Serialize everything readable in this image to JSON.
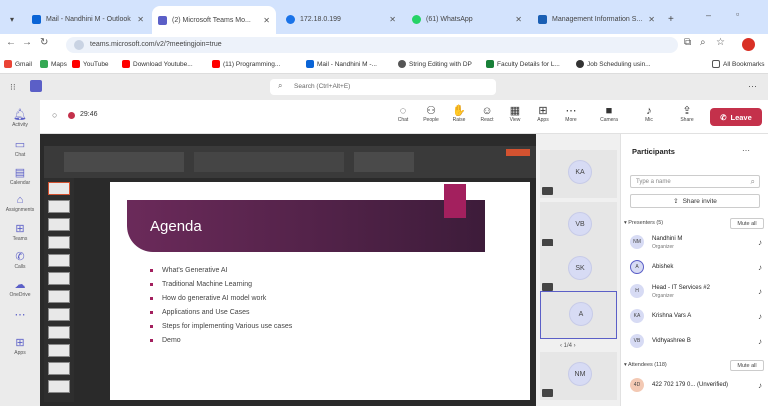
{
  "browser": {
    "tabs": [
      {
        "title": "Mail - Nandhini M - Outlook",
        "color": "#0a64d6"
      },
      {
        "title": "(2) Microsoft Teams Mo...",
        "color": "#5b5fc7",
        "active": true
      },
      {
        "title": "172.18.0.199",
        "color": "#1a73e8"
      },
      {
        "title": "(61) WhatsApp",
        "color": "#25d366"
      },
      {
        "title": "Management Information S...",
        "color": "#1a5fb4"
      }
    ],
    "url": "teams.microsoft.com/v2/?meetingjoin=true",
    "bookmarks": [
      "Gmail",
      "Maps",
      "YouTube",
      "Download Youtube...",
      "(11) Programming...",
      "Mail - Nandhini M -...",
      "String Editing with DP",
      "Faculty Details for L...",
      "Job Scheduling usin..."
    ],
    "all_bookmarks": "All Bookmarks"
  },
  "teams": {
    "search_placeholder": "Search (Ctrl+Alt+E)",
    "timer": "29:46",
    "controls": [
      {
        "label": "Chat",
        "icon": "chat-icon",
        "glyph": "◌"
      },
      {
        "label": "People",
        "icon": "people-icon",
        "glyph": "⚇"
      },
      {
        "label": "Raise",
        "icon": "raise-hand-icon",
        "glyph": "✋"
      },
      {
        "label": "React",
        "icon": "react-icon",
        "glyph": "☺"
      },
      {
        "label": "View",
        "icon": "view-icon",
        "glyph": "▦"
      },
      {
        "label": "Apps",
        "icon": "apps-icon",
        "glyph": "⊞"
      },
      {
        "label": "More",
        "icon": "more-icon",
        "glyph": "⋯"
      },
      {
        "label": "Camera",
        "icon": "camera-icon",
        "glyph": "■"
      },
      {
        "label": "Mic",
        "icon": "mic-icon",
        "glyph": "♪"
      },
      {
        "label": "Share",
        "icon": "share-icon",
        "glyph": "⇪"
      }
    ],
    "leave_label": "Leave",
    "rail": [
      "Activity",
      "Chat",
      "Calendar",
      "Assignments",
      "Teams",
      "Calls",
      "OneDrive",
      "",
      "Apps"
    ]
  },
  "slide": {
    "title": "Agenda",
    "bullets": [
      "What's Generative AI",
      "Traditional Machine Learning",
      "How do generative AI model work",
      "Applications and Use Cases",
      "Steps for implementing Various use cases",
      "Demo"
    ]
  },
  "videos": [
    "KA",
    "VB",
    "SK",
    "A",
    "NM"
  ],
  "pager": "1/4",
  "participants": {
    "title": "Participants",
    "type_placeholder": "Type a name",
    "share_invite": "Share invite",
    "presenters_label": "Presenters (5)",
    "attendees_label": "Attendees (118)",
    "mute_all": "Mute all",
    "presenters": [
      {
        "initials": "NM",
        "name": "Nandhini M",
        "role": "Organizer"
      },
      {
        "initials": "A",
        "name": "Abishek",
        "role": ""
      },
      {
        "initials": "H",
        "name": "Head - IT Services #2",
        "role": "Organizer"
      },
      {
        "initials": "KA",
        "name": "Krishna Vars A",
        "role": ""
      },
      {
        "initials": "VB",
        "name": "Vidhyashree B",
        "role": ""
      }
    ],
    "attendees": [
      {
        "initials": "4D",
        "name": "422 702 179 0... (Unverified)",
        "role": ""
      }
    ]
  }
}
